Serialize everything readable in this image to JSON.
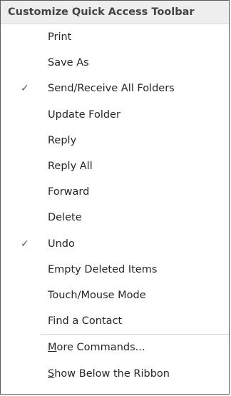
{
  "menu": {
    "title": "Customize Quick Access Toolbar",
    "check_glyph": "✓",
    "items": [
      {
        "label": "Print",
        "checked": false
      },
      {
        "label": "Save As",
        "checked": false
      },
      {
        "label": "Send/Receive All Folders",
        "checked": true
      },
      {
        "label": "Update Folder",
        "checked": false
      },
      {
        "label": "Reply",
        "checked": false
      },
      {
        "label": "Reply All",
        "checked": false
      },
      {
        "label": "Forward",
        "checked": false
      },
      {
        "label": "Delete",
        "checked": false
      },
      {
        "label": "Undo",
        "checked": true
      },
      {
        "label": "Empty Deleted Items",
        "checked": false
      },
      {
        "label": "Touch/Mouse Mode",
        "checked": false
      },
      {
        "label": "Find a Contact",
        "checked": false
      }
    ],
    "commands": [
      {
        "accel": "M",
        "rest": "ore Commands..."
      },
      {
        "accel": "S",
        "rest": "how Below the Ribbon"
      }
    ]
  }
}
